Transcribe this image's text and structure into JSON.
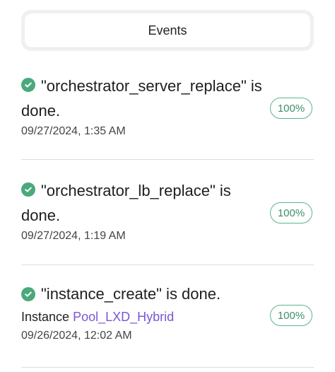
{
  "header": {
    "title": "Events"
  },
  "events": [
    {
      "status": "success",
      "title_line1": "\"orchestrator_server_replace\" is",
      "title_line2": "done.",
      "timestamp": "09/27/2024, 1:35 AM",
      "progress_label": "100%",
      "progress": 100
    },
    {
      "status": "success",
      "title_line1": "\"orchestrator_lb_replace\" is",
      "title_line2": "done.",
      "timestamp": "09/27/2024, 1:19 AM",
      "progress_label": "100%",
      "progress": 100
    },
    {
      "status": "success",
      "title_line1": "\"instance_create\" is done.",
      "instance_prefix": "Instance",
      "instance_link": "Pool_LXD_Hybrid",
      "timestamp": "09/26/2024, 12:02 AM",
      "progress_label": "100%",
      "progress": 100
    }
  ],
  "colors": {
    "success": "#4aa97c",
    "link": "#7b55d6",
    "divider": "#d9dde2",
    "header_bg": "#eef0f3"
  },
  "icons": {
    "status": "check-circle-icon"
  }
}
